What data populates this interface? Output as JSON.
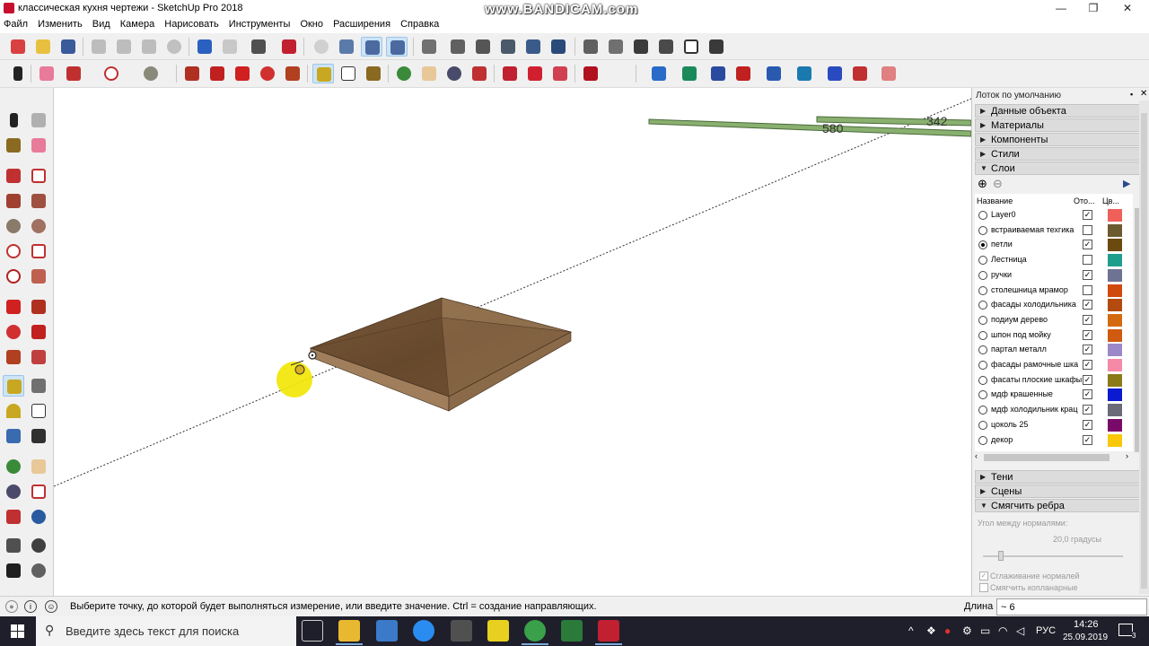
{
  "window": {
    "title": "классическая кухня чертежи - SketchUp Pro 2018",
    "watermark": "www.BANDICAM.com",
    "controls": {
      "minimize": "—",
      "maximize": "❐",
      "close": "✕"
    }
  },
  "menu": [
    "Файл",
    "Изменить",
    "Вид",
    "Камера",
    "Нарисовать",
    "Инструменты",
    "Окно",
    "Расширения",
    "Справка"
  ],
  "viewport": {
    "dim_label_1": "580",
    "dim_label_2": "342"
  },
  "tray": {
    "title": "Лоток по умолчанию",
    "panels_top": [
      {
        "label": "Данные объекта",
        "expanded": false
      },
      {
        "label": "Материалы",
        "expanded": false
      },
      {
        "label": "Компоненты",
        "expanded": false
      },
      {
        "label": "Стили",
        "expanded": false
      },
      {
        "label": "Слои",
        "expanded": true
      }
    ],
    "layers": {
      "col_name": "Название",
      "col_visible": "Ото...",
      "col_color": "Цв...",
      "rows": [
        {
          "name": "Layer0",
          "active": false,
          "visible": true,
          "color": "#f0605a"
        },
        {
          "name": "встраиваемая техгика",
          "active": false,
          "visible": false,
          "color": "#6b5b2e"
        },
        {
          "name": "петли",
          "active": true,
          "visible": true,
          "color": "#6b4a10"
        },
        {
          "name": "Лестница",
          "active": false,
          "visible": false,
          "color": "#1f9e8e"
        },
        {
          "name": "ручки",
          "active": false,
          "visible": true,
          "color": "#6e7393"
        },
        {
          "name": "столешница мрамор",
          "active": false,
          "visible": false,
          "color": "#d04a10"
        },
        {
          "name": "фасады холодильника",
          "active": false,
          "visible": true,
          "color": "#b34a10"
        },
        {
          "name": "подиум дерево",
          "active": false,
          "visible": true,
          "color": "#d46a10"
        },
        {
          "name": "шпон под мойку",
          "active": false,
          "visible": true,
          "color": "#d05a10"
        },
        {
          "name": "партал металл",
          "active": false,
          "visible": true,
          "color": "#9b88c8"
        },
        {
          "name": "фасады рамочные шка",
          "active": false,
          "visible": true,
          "color": "#f48aa8"
        },
        {
          "name": "фасаты плоские шкафы",
          "active": false,
          "visible": true,
          "color": "#8a7a18"
        },
        {
          "name": "мдф крашенные",
          "active": false,
          "visible": true,
          "color": "#0a1ad0"
        },
        {
          "name": "мдф холодильник крац",
          "active": false,
          "visible": true,
          "color": "#6a6a78"
        },
        {
          "name": "цоколь 25",
          "active": false,
          "visible": true,
          "color": "#7a0a6a"
        },
        {
          "name": "декор",
          "active": false,
          "visible": true,
          "color": "#f8c808"
        }
      ]
    },
    "panels_bottom": [
      {
        "label": "Тени",
        "expanded": false
      },
      {
        "label": "Сцены",
        "expanded": false
      },
      {
        "label": "Смягчить ребра",
        "expanded": true
      }
    ],
    "smooth": {
      "angle_label": "Угол между нормалями:",
      "angle_value": "20,0 градусы",
      "angle_fraction": 0.11,
      "opt_smooth_normals": "Сглаживание нормалей",
      "opt_smooth_normals_checked": true,
      "opt_coplanar": "Смягчить копланарные",
      "opt_coplanar_checked": false
    }
  },
  "status": {
    "message": "Выберите точку, до которой будет выполняться измерение, или введите значение.  Ctrl = создание направляющих.",
    "measure_label": "Длина",
    "measure_value": "~ 6"
  },
  "taskbar": {
    "search_placeholder": "Введите здесь текст для поиска",
    "lang": "РУС",
    "time": "14:26",
    "date": "25.09.2019",
    "notifications": "3"
  },
  "colors": {
    "toolbar_bg": "#f0f0f0",
    "active_tool": "#cde4f7",
    "board_wood": "#7a5838",
    "board_edge": "#8b6440",
    "taskbar": "#1f1f2b"
  }
}
